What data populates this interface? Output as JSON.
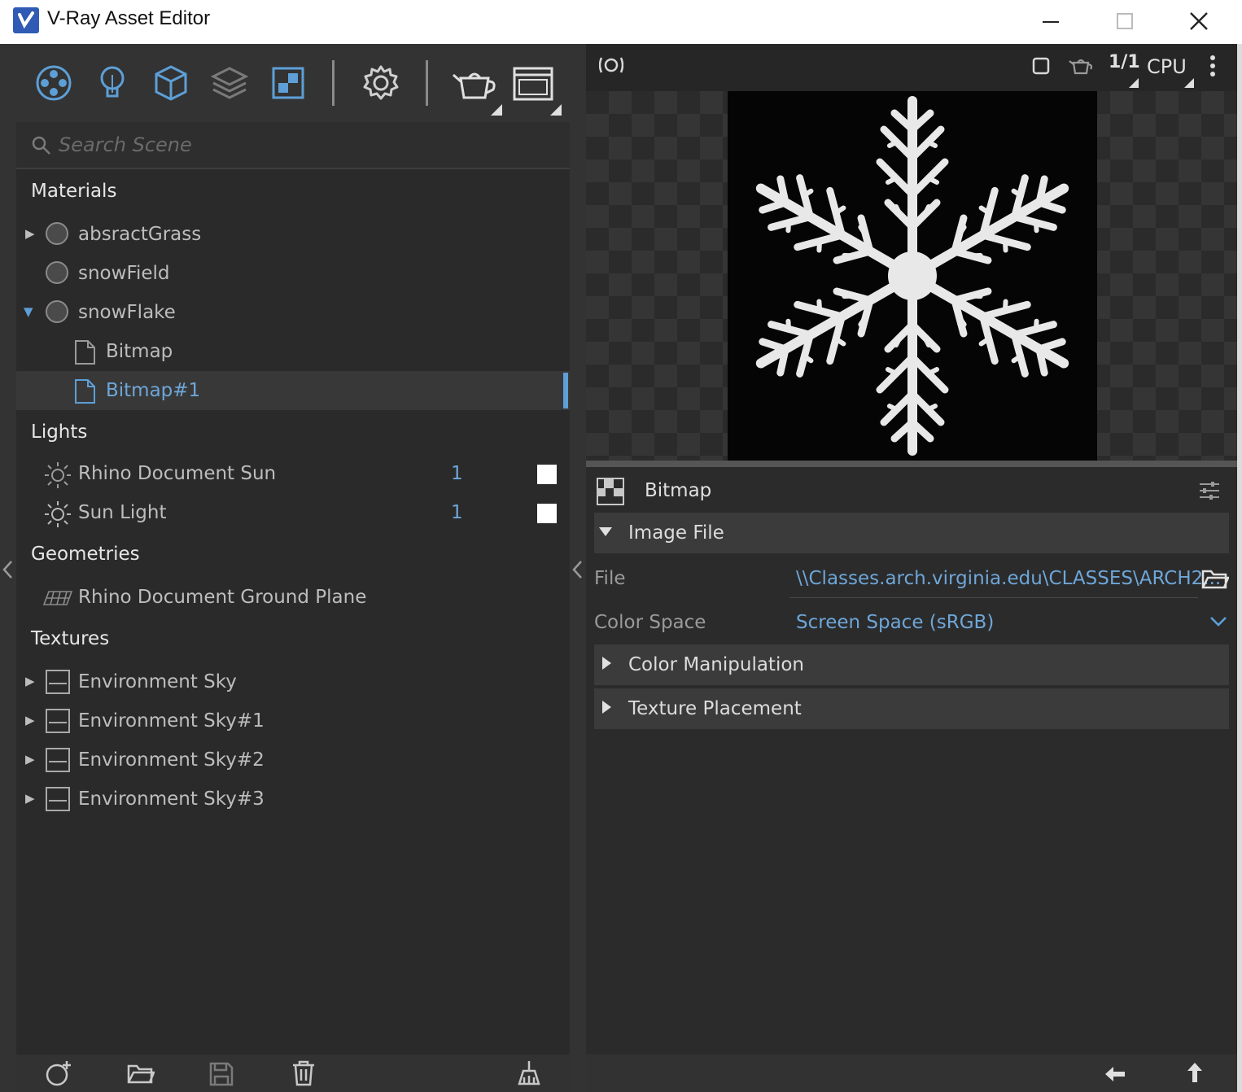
{
  "window": {
    "title": "V-Ray Asset Editor",
    "buttons": [
      "minimize",
      "maximize",
      "close"
    ]
  },
  "toolbar": {
    "icons": [
      "materials-icon",
      "lights-icon",
      "geometry-icon",
      "render-elements-icon",
      "textures-icon",
      "settings-icon",
      "render-teapot-icon",
      "render-window-icon"
    ]
  },
  "search": {
    "placeholder": "Search Scene"
  },
  "sections": {
    "materials": "Materials",
    "lights": "Lights",
    "geometries": "Geometries",
    "textures": "Textures"
  },
  "materials": [
    {
      "label": "absractGrass",
      "expander": "▶"
    },
    {
      "label": "snowField",
      "expander": ""
    },
    {
      "label": "snowFlake",
      "expander": "▼"
    }
  ],
  "material_children": [
    {
      "label": "Bitmap"
    },
    {
      "label": "Bitmap#1",
      "selected": true
    }
  ],
  "lights": [
    {
      "label": "Rhino Document Sun",
      "count": "1",
      "enabled": true
    },
    {
      "label": "Sun Light",
      "count": "1",
      "enabled": true
    }
  ],
  "geometries": [
    {
      "label": "Rhino Document Ground Plane"
    }
  ],
  "textures": [
    {
      "label": "Environment Sky"
    },
    {
      "label": "Environment Sky#1"
    },
    {
      "label": "Environment Sky#2"
    },
    {
      "label": "Environment Sky#3"
    }
  ],
  "preview_toolbar": {
    "ratio": "1/1",
    "engine": "CPU"
  },
  "properties": {
    "asset_type": "Bitmap",
    "image_file_group": "Image File",
    "file_label": "File",
    "file_value": "\\\\Classes.arch.virginia.edu\\CLASSES\\ARCH2...",
    "color_space_label": "Color Space",
    "color_space_value": "Screen Space (sRGB)",
    "color_manipulation_group": "Color Manipulation",
    "texture_placement_group": "Texture Placement"
  },
  "colors": {
    "accent": "#5d9fd6",
    "panel": "#2a2a2a",
    "titlebar": "#ffffff"
  }
}
